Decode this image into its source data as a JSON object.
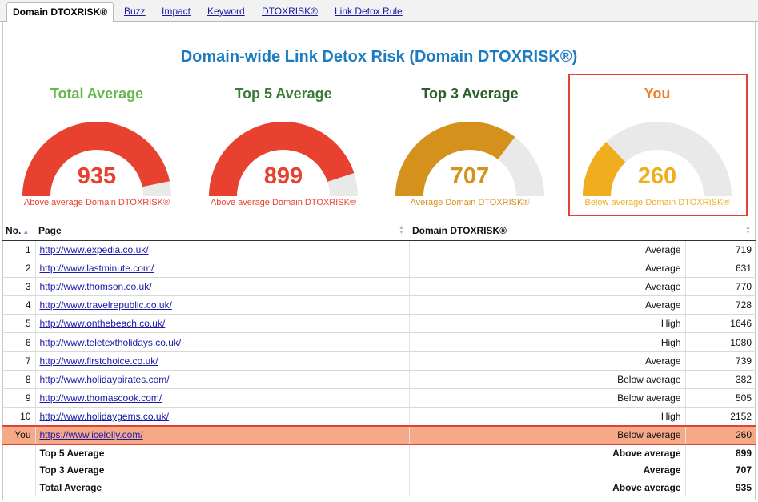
{
  "tabs": [
    {
      "label": "Domain DTOXRISK®",
      "active": true
    },
    {
      "label": "Buzz",
      "active": false
    },
    {
      "label": "Impact",
      "active": false
    },
    {
      "label": "Keyword",
      "active": false
    },
    {
      "label": "DTOXRISK®",
      "active": false
    },
    {
      "label": "Link Detox Rule",
      "active": false
    }
  ],
  "page_title": "Domain-wide Link Detox Risk (Domain DTOXRISK®)",
  "colors": {
    "title": "#1c7cbf",
    "high": "#e8412f",
    "average": "#d4921c",
    "below": "#f0ae1e",
    "track": "#e9e9e9",
    "highlight_border": "#e0432f",
    "highlight_fill": "#f6a986"
  },
  "gauges": [
    {
      "title": "Total Average",
      "title_color": "#66b84d",
      "value": "935",
      "fraction": 0.935,
      "caption": "Above average Domain DTOXRISK®",
      "color": "#e8412f"
    },
    {
      "title": "Top 5 Average",
      "title_color": "#3d7b3a",
      "value": "899",
      "fraction": 0.899,
      "caption": "Above average Domain DTOXRISK®",
      "color": "#e8412f"
    },
    {
      "title": "Top 3 Average",
      "title_color": "#2b5f2a",
      "value": "707",
      "fraction": 0.707,
      "caption": "Average Domain DTOXRISK®",
      "color": "#d4921c"
    },
    {
      "title": "You",
      "title_color": "#ef7d2a",
      "value": "260",
      "fraction": 0.26,
      "caption": "Below average Domain DTOXRISK®",
      "color": "#f0ae1e"
    }
  ],
  "table": {
    "headers": {
      "no": "No.",
      "page": "Page",
      "risk": "Domain DTOXRISK®"
    },
    "rows": [
      {
        "no": "1",
        "page": "http://www.expedia.co.uk/",
        "level": "Average",
        "score": "719"
      },
      {
        "no": "2",
        "page": "http://www.lastminute.com/",
        "level": "Average",
        "score": "631"
      },
      {
        "no": "3",
        "page": "http://www.thomson.co.uk/",
        "level": "Average",
        "score": "770"
      },
      {
        "no": "4",
        "page": "http://www.travelrepublic.co.uk/",
        "level": "Average",
        "score": "728"
      },
      {
        "no": "5",
        "page": "http://www.onthebeach.co.uk/",
        "level": "High",
        "score": "1646"
      },
      {
        "no": "6",
        "page": "http://www.teletextholidays.co.uk/",
        "level": "High",
        "score": "1080"
      },
      {
        "no": "7",
        "page": "http://www.firstchoice.co.uk/",
        "level": "Average",
        "score": "739"
      },
      {
        "no": "8",
        "page": "http://www.holidaypirates.com/",
        "level": "Below average",
        "score": "382"
      },
      {
        "no": "9",
        "page": "http://www.thomascook.com/",
        "level": "Below average",
        "score": "505"
      },
      {
        "no": "10",
        "page": "http://www.holidaygems.co.uk/",
        "level": "High",
        "score": "2152"
      }
    ],
    "you_row": {
      "no": "You",
      "page": "https://www.icelolly.com/",
      "level": "Below average",
      "score": "260"
    },
    "summary": [
      {
        "label": "Top 5 Average",
        "level": "Above average",
        "score": "899"
      },
      {
        "label": "Top 3 Average",
        "level": "Average",
        "score": "707"
      },
      {
        "label": "Total Average",
        "level": "Above average",
        "score": "935"
      }
    ]
  }
}
